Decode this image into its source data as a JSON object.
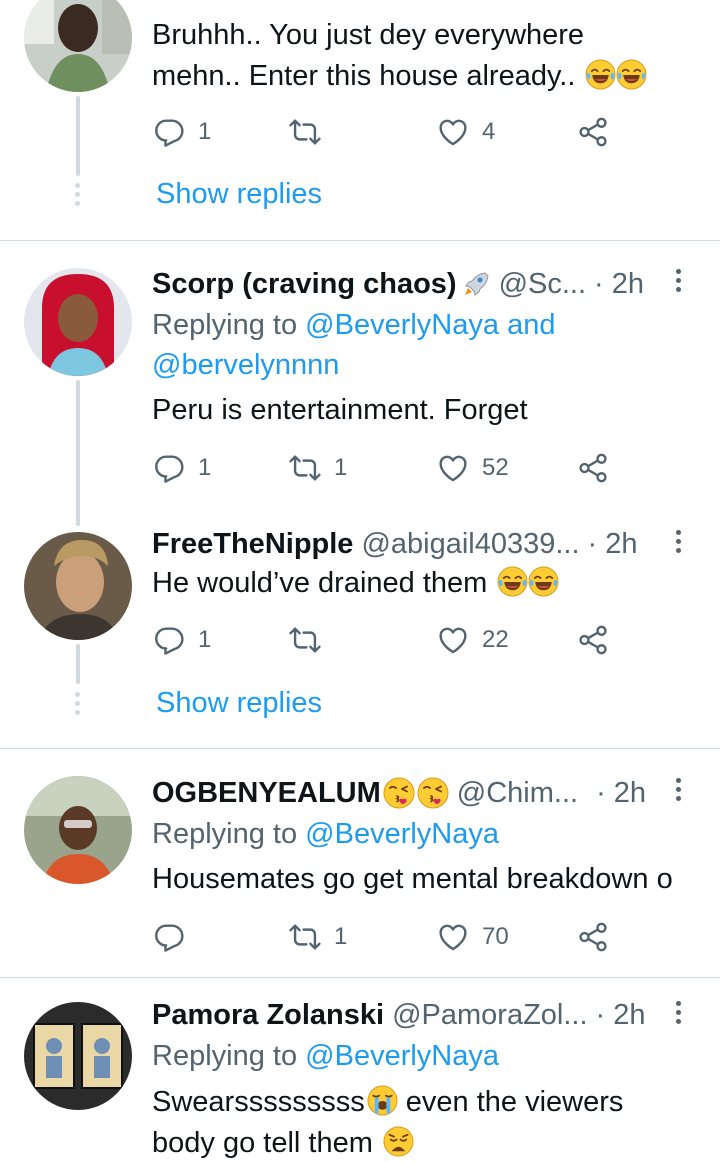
{
  "tweets": [
    {
      "lines": [
        "Bruhhh.. You just dey everywhere",
        "mehn.. Enter this house already.."
      ],
      "reply_count": "1",
      "retweet_count": "",
      "like_count": "4",
      "show_replies": "Show replies"
    },
    {
      "name": "Scorp (craving chaos)",
      "handle": "@Sc...",
      "separator": "·",
      "time": "2h",
      "replying_prefix": "Replying to",
      "replying_link1": "@BeverlyNaya",
      "replying_and": "and",
      "replying_link2": "@bervelynnnn",
      "text": "Peru is entertainment. Forget",
      "reply_count": "1",
      "retweet_count": "1",
      "like_count": "52"
    },
    {
      "name": "FreeTheNipple",
      "handle": "@abigail40339...",
      "separator": "·",
      "time": "2h",
      "text": "He would’ve drained them",
      "reply_count": "1",
      "retweet_count": "",
      "like_count": "22",
      "show_replies": "Show replies"
    },
    {
      "name": "OGBENYEALUM",
      "handle": "@Chim...",
      "separator": "·",
      "time": "2h",
      "replying_prefix": "Replying to",
      "replying_link1": "@BeverlyNaya",
      "text": "Housemates go get mental breakdown o",
      "reply_count": "",
      "retweet_count": "1",
      "like_count": "70"
    },
    {
      "name": "Pamora Zolanski",
      "handle": "@PamoraZol...",
      "separator": "·",
      "time": "2h",
      "replying_prefix": "Replying to",
      "replying_link1": "@BeverlyNaya",
      "text_line1_a": "Swearsssssssss",
      "text_line1_b": " even the viewers",
      "text_line2": "body go tell them"
    }
  ],
  "icons": {
    "reply": "reply-icon",
    "retweet": "retweet-icon",
    "like": "heart-icon",
    "share": "share-icon",
    "more": "more-icon"
  },
  "colors": {
    "text": "#0f1419",
    "secondary": "#536471",
    "link": "#1d9bf0",
    "divider": "#cfd9de"
  }
}
